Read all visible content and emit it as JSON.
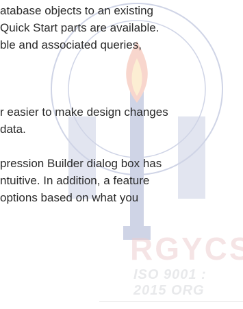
{
  "text_lines": [
    {
      "text": "atabase objects to an existing",
      "lead": ""
    },
    {
      "text": "Quick Start parts are available.",
      "lead": ""
    },
    {
      "text": "ble and associated queries,",
      "lead": ""
    },
    {
      "text": "r easier to make design changes",
      "lead": ""
    },
    {
      "text": "data.",
      "lead": ""
    },
    {
      "text": "pression Builder dialog box has",
      "lead": ""
    },
    {
      "text": "ntuitive. In addition, a feature",
      "lead": ""
    },
    {
      "text": "options based on what you",
      "lead": ""
    }
  ],
  "watermark": {
    "brand": "RGYCSM",
    "iso": "ISO 9001 : 2015 ORG",
    "colors": {
      "brand": "#b0232a",
      "seal": "#2a3f8f",
      "flame": "#e04b1f"
    }
  }
}
